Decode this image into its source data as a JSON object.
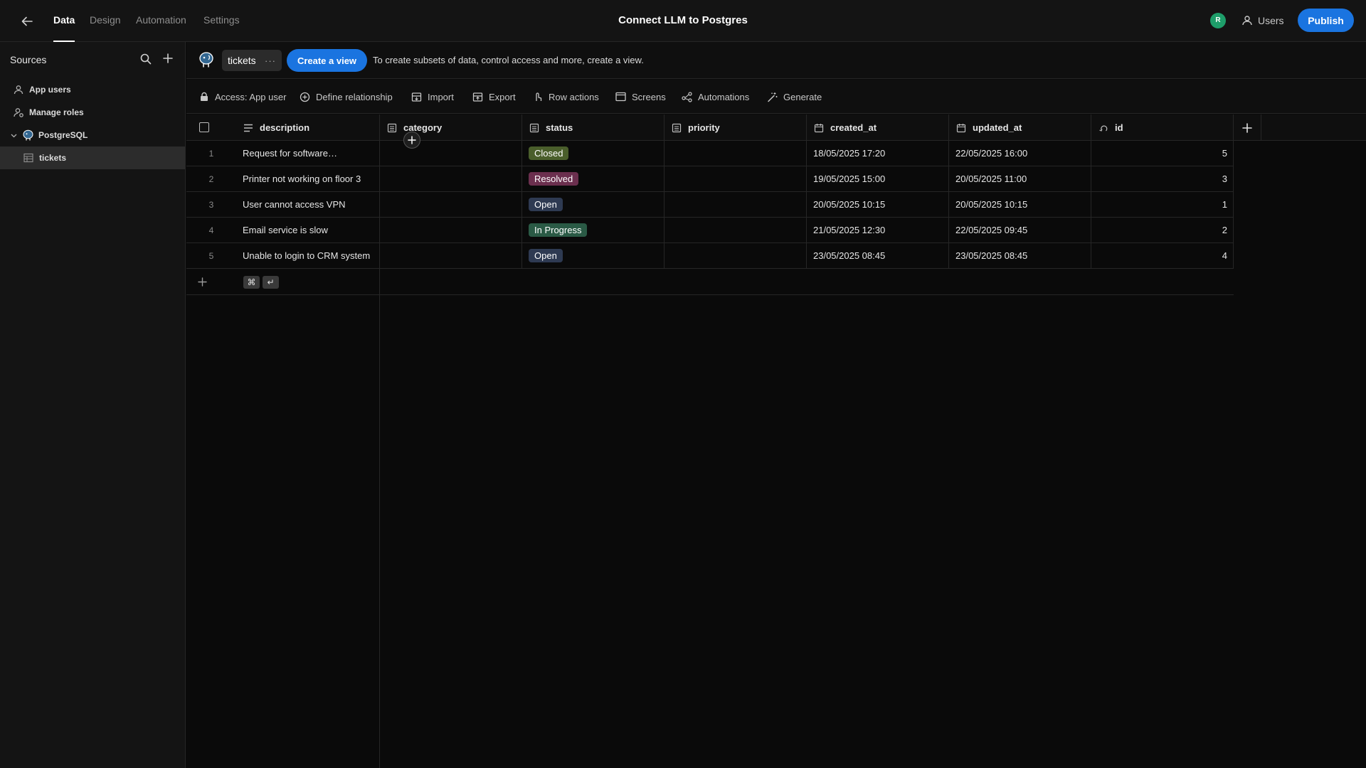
{
  "header": {
    "tabs": [
      {
        "label": "Data",
        "active": true
      },
      {
        "label": "Design",
        "active": false
      },
      {
        "label": "Automation",
        "active": false
      },
      {
        "label": "Settings",
        "active": false
      }
    ],
    "title": "Connect LLM to Postgres",
    "avatar_initial": "R",
    "users_label": "Users",
    "publish_label": "Publish"
  },
  "sidebar": {
    "title": "Sources",
    "items": [
      {
        "label": "App users",
        "icon": "user-icon"
      },
      {
        "label": "Manage roles",
        "icon": "roles-icon"
      },
      {
        "label": "PostgreSQL",
        "icon": "postgres-icon",
        "expanded": true
      },
      {
        "label": "tickets",
        "icon": "table-icon",
        "selected": true
      }
    ]
  },
  "tablebar": {
    "table_name": "tickets",
    "more_label": "···",
    "create_view_label": "Create a view",
    "hint": "To create subsets of data, control access and more, create a view."
  },
  "toolbar": {
    "items": [
      {
        "label": "Access: App user",
        "icon": "lock-icon"
      },
      {
        "label": "Define relationship",
        "icon": "relationship-icon"
      },
      {
        "label": "Import",
        "icon": "import-icon"
      },
      {
        "label": "Export",
        "icon": "export-icon"
      },
      {
        "label": "Row actions",
        "icon": "row-actions-icon"
      },
      {
        "label": "Screens",
        "icon": "screen-icon"
      },
      {
        "label": "Automations",
        "icon": "automation-icon"
      },
      {
        "label": "Generate",
        "icon": "magic-wand-icon"
      }
    ]
  },
  "grid": {
    "columns": [
      "description",
      "category",
      "status",
      "priority",
      "created_at",
      "updated_at",
      "id"
    ],
    "rows": [
      {
        "num": "1",
        "description": "Request for software…",
        "category": "",
        "status": "Closed",
        "priority": "",
        "created_at": "18/05/2025 17:20",
        "updated_at": "22/05/2025 16:00",
        "id": "5"
      },
      {
        "num": "2",
        "description": "Printer not working on floor 3",
        "category": "",
        "status": "Resolved",
        "priority": "",
        "created_at": "19/05/2025 15:00",
        "updated_at": "20/05/2025 11:00",
        "id": "3"
      },
      {
        "num": "3",
        "description": "User cannot access VPN",
        "category": "",
        "status": "Open",
        "priority": "",
        "created_at": "20/05/2025 10:15",
        "updated_at": "20/05/2025 10:15",
        "id": "1"
      },
      {
        "num": "4",
        "description": "Email service is slow",
        "category": "",
        "status": "In Progress",
        "priority": "",
        "created_at": "21/05/2025 12:30",
        "updated_at": "22/05/2025 09:45",
        "id": "2"
      },
      {
        "num": "5",
        "description": "Unable to login to CRM system",
        "category": "",
        "status": "Open",
        "priority": "",
        "created_at": "23/05/2025 08:45",
        "updated_at": "23/05/2025 08:45",
        "id": "4"
      }
    ],
    "status_colors": {
      "Closed": "#4a5e2b",
      "Resolved": "#6b2f4e",
      "Open": "#2e3a52",
      "In Progress": "#2a5a45"
    },
    "shortcut_keys": [
      "⌘",
      "↵"
    ]
  },
  "colors": {
    "accent": "#1a74e0",
    "avatar": "#1e9e6a"
  }
}
